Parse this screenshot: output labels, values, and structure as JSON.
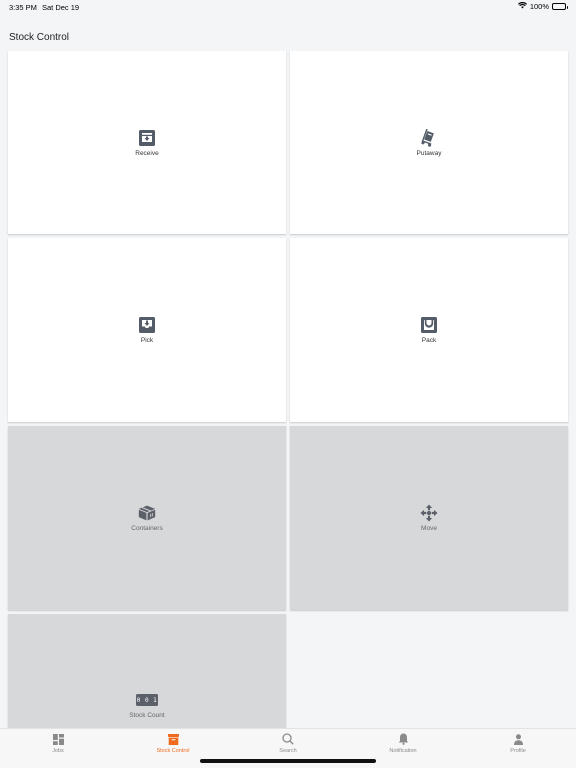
{
  "status_bar": {
    "time": "3:35 PM",
    "date": "Sat Dec 19",
    "battery": "100%",
    "wifi_icon": "wifi-icon",
    "battery_icon": "battery-icon"
  },
  "page": {
    "title": "Stock Control"
  },
  "tiles": [
    {
      "label": "Receive",
      "icon": "receive-icon",
      "enabled": true
    },
    {
      "label": "Putaway",
      "icon": "hand-truck-icon",
      "enabled": true
    },
    {
      "label": "Pick",
      "icon": "pick-icon",
      "enabled": true
    },
    {
      "label": "Pack",
      "icon": "pack-icon",
      "enabled": true
    },
    {
      "label": "Containers",
      "icon": "box-icon",
      "enabled": false
    },
    {
      "label": "Move",
      "icon": "move-arrows-icon",
      "enabled": false
    },
    {
      "label": "Stock Count",
      "icon": "counter-icon",
      "enabled": false
    }
  ],
  "stock_count_digits": "0 0 1",
  "tab_bar": {
    "items": [
      {
        "label": "Jobs",
        "icon": "grid-icon",
        "active": false
      },
      {
        "label": "Stock Control",
        "icon": "archive-icon",
        "active": true
      },
      {
        "label": "Search",
        "icon": "search-icon",
        "active": false
      },
      {
        "label": "Notification",
        "icon": "bell-icon",
        "active": false
      },
      {
        "label": "Profile",
        "icon": "person-icon",
        "active": false
      }
    ]
  },
  "colors": {
    "accent": "#ef6a1f",
    "icon_dark": "#545d67",
    "disabled_tile": "#d7d8da",
    "background": "#f4f5f7"
  }
}
